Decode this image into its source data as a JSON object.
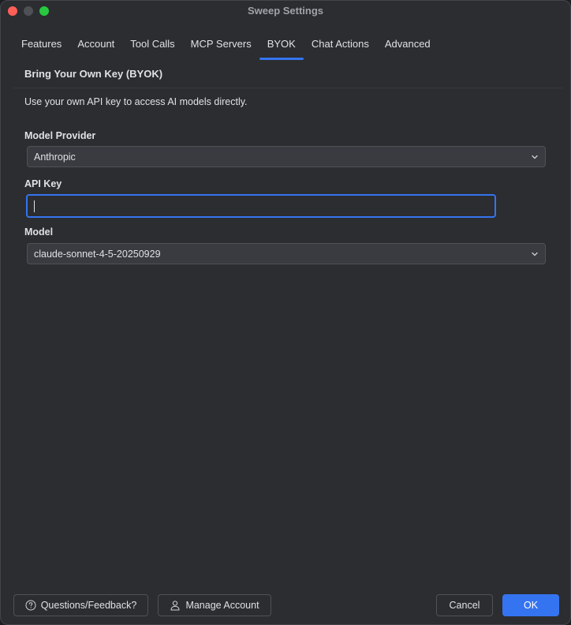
{
  "window": {
    "title": "Sweep Settings"
  },
  "tabs": [
    {
      "label": "Features"
    },
    {
      "label": "Account"
    },
    {
      "label": "Tool Calls"
    },
    {
      "label": "MCP Servers"
    },
    {
      "label": "BYOK"
    },
    {
      "label": "Chat Actions"
    },
    {
      "label": "Advanced"
    }
  ],
  "active_tab": "BYOK",
  "byok": {
    "title": "Bring Your Own Key (BYOK)",
    "description": "Use your own API key to access AI models directly.",
    "provider_label": "Model Provider",
    "provider_value": "Anthropic",
    "api_key_label": "API Key",
    "api_key_value": "",
    "model_label": "Model",
    "model_value": "claude-sonnet-4-5-20250929"
  },
  "footer": {
    "feedback_label": "Questions/Feedback?",
    "manage_label": "Manage Account",
    "cancel_label": "Cancel",
    "ok_label": "OK"
  },
  "colors": {
    "accent": "#3574f0",
    "background": "#2b2d30",
    "traffic_close": "#ff5f57",
    "traffic_max": "#28c840"
  },
  "icons": {
    "feedback": "question-circle-icon",
    "manage": "person-icon",
    "dropdown": "chevron-down-icon"
  }
}
